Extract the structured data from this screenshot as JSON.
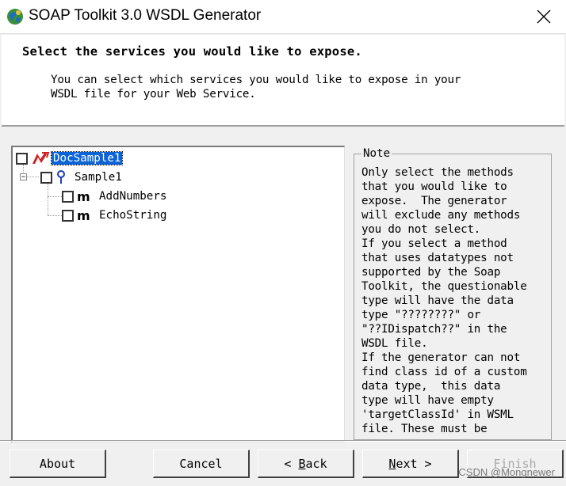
{
  "window": {
    "title": "SOAP Toolkit 3.0 WSDL Generator",
    "close_glyph": "✕"
  },
  "header": {
    "title": "Select the services you would like to expose.",
    "description_line1": "You can select which services you would like to expose in your",
    "description_line2": "WSDL file for your Web Service."
  },
  "tree": {
    "root": {
      "label": "DocSample1",
      "checked": false,
      "selected": true,
      "icon": "component-icon"
    },
    "child": {
      "label": "Sample1",
      "checked": false,
      "icon": "interface-icon",
      "expander": "−"
    },
    "methods": [
      {
        "label": "AddNumbers",
        "icon_glyph": "m",
        "checked": false
      },
      {
        "label": "EchoString",
        "icon_glyph": "m",
        "checked": false
      }
    ]
  },
  "note": {
    "legend": "Note",
    "text": "Only select the methods\nthat you would like to\nexpose.  The generator\nwill exclude any methods\nyou do not select.\nIf you select a method\nthat uses datatypes not\nsupported by the Soap\nToolkit, the questionable\ntype will have the data\ntype \"????????\" or\n\"??IDispatch??\" in the\nWSDL file.\nIf the generator can not\nfind class id of a custom\ndata type,  this data\ntype will have empty\n'targetClassId' in WSML\nfile. These must be"
  },
  "buttons": {
    "about": "About",
    "cancel": "Cancel",
    "back_prefix": "< ",
    "back_key": "B",
    "back_rest": "ack",
    "next_key": "N",
    "next_rest": "ext >",
    "finish": "Finish"
  },
  "watermark": "CSDN @Mongnewer",
  "colors": {
    "selection": "#0a64d6",
    "face": "#f0f0f0"
  }
}
